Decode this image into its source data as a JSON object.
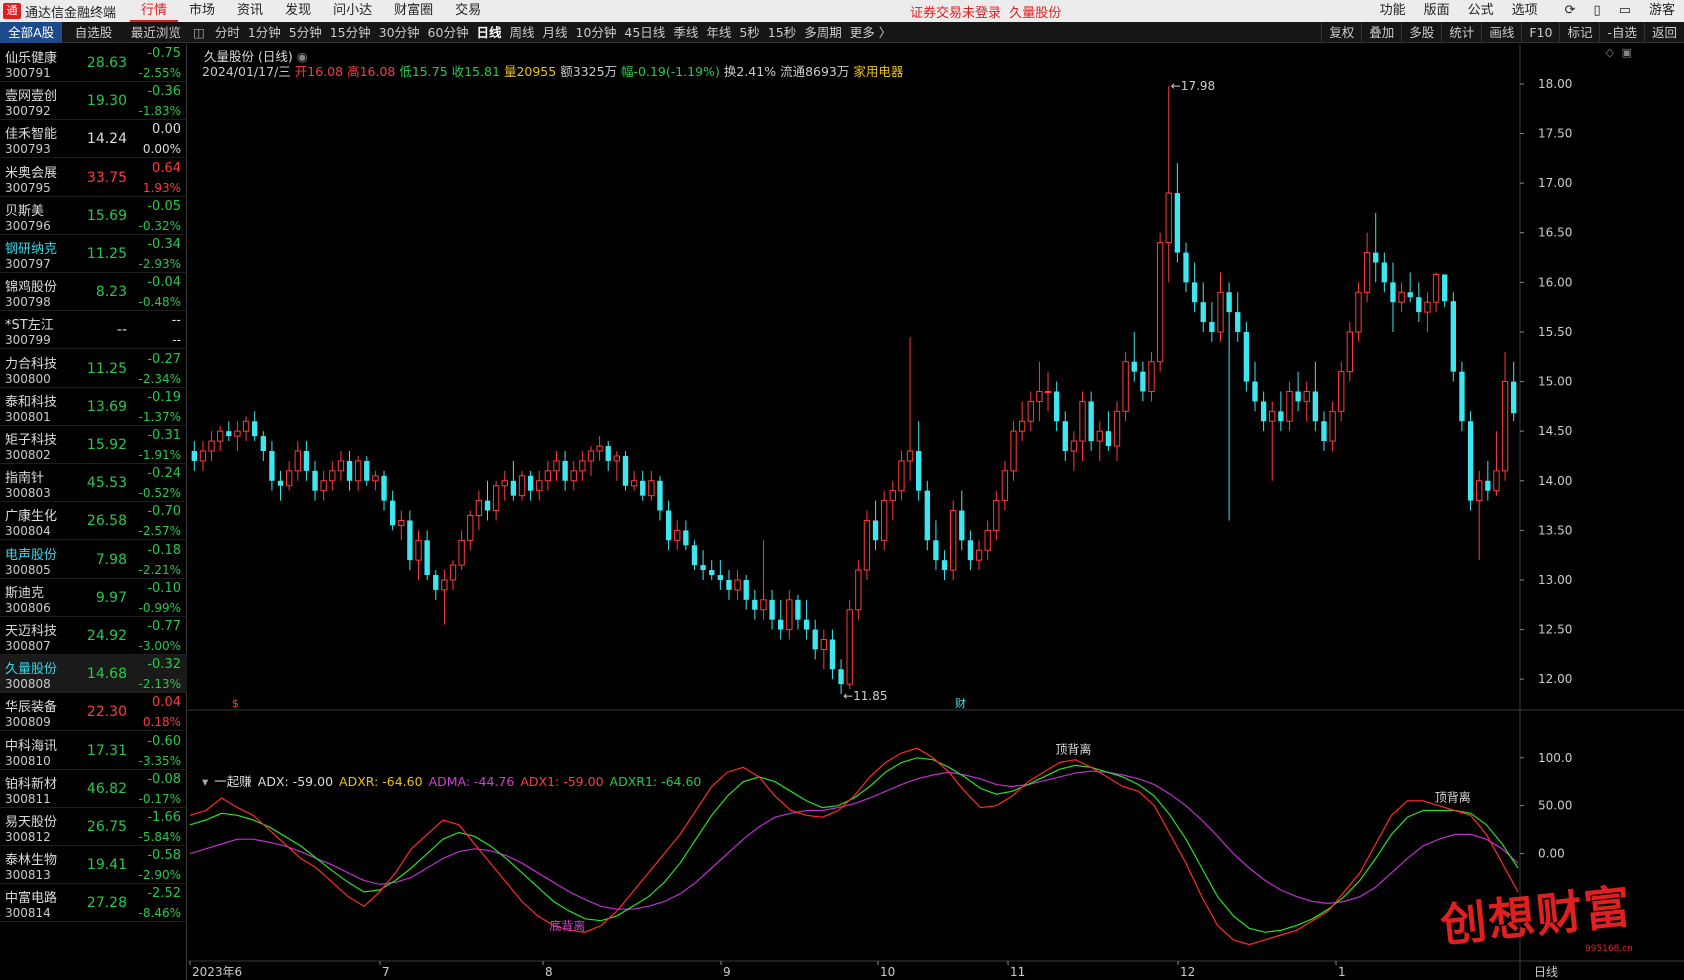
{
  "app": {
    "title": "通达信金融终端",
    "logo": "通",
    "notice": "证券交易未登录",
    "notice_stock": "久量股份"
  },
  "menu": [
    "行情",
    "市场",
    "资讯",
    "发现",
    "问小达",
    "财富圈",
    "交易"
  ],
  "menu_active": 0,
  "right_menu": [
    "功能",
    "版面",
    "公式",
    "选项"
  ],
  "guest": "游客",
  "sidebar_tabs": [
    "全部A股",
    "自选股",
    "最近浏览"
  ],
  "periods": [
    "分时",
    "1分钟",
    "5分钟",
    "15分钟",
    "30分钟",
    "60分钟",
    "日线",
    "周线",
    "月线",
    "10分钟",
    "45日线",
    "季线",
    "年线",
    "5秒",
    "15秒",
    "多周期",
    "更多 〉"
  ],
  "period_active": 6,
  "tools": [
    "复权",
    "叠加",
    "多股",
    "统计",
    "画线",
    "F10",
    "标记",
    "-自选",
    "返回"
  ],
  "stocks": [
    {
      "name": "仙乐健康",
      "code": "300791",
      "price": "28.63",
      "chg": "-0.75",
      "pct": "-2.55%",
      "dir": "dn"
    },
    {
      "name": "壹网壹创",
      "code": "300792",
      "price": "19.30",
      "chg": "-0.36",
      "pct": "-1.83%",
      "dir": "dn"
    },
    {
      "name": "佳禾智能",
      "code": "300793",
      "price": "14.24",
      "chg": "0.00",
      "pct": "0.00%",
      "dir": "fl"
    },
    {
      "name": "米奥会展",
      "code": "300795",
      "price": "33.75",
      "chg": "0.64",
      "pct": "1.93%",
      "dir": "up"
    },
    {
      "name": "贝斯美",
      "code": "300796",
      "price": "15.69",
      "chg": "-0.05",
      "pct": "-0.32%",
      "dir": "dn"
    },
    {
      "name": "钢研纳克",
      "code": "300797",
      "price": "11.25",
      "chg": "-0.34",
      "pct": "-2.93%",
      "dir": "dn",
      "hl": true
    },
    {
      "name": "锦鸡股份",
      "code": "300798",
      "price": "8.23",
      "chg": "-0.04",
      "pct": "-0.48%",
      "dir": "dn"
    },
    {
      "name": "*ST左江",
      "code": "300799",
      "price": "--",
      "chg": "--",
      "pct": "--",
      "dir": "fl"
    },
    {
      "name": "力合科技",
      "code": "300800",
      "price": "11.25",
      "chg": "-0.27",
      "pct": "-2.34%",
      "dir": "dn"
    },
    {
      "name": "泰和科技",
      "code": "300801",
      "price": "13.69",
      "chg": "-0.19",
      "pct": "-1.37%",
      "dir": "dn"
    },
    {
      "name": "矩子科技",
      "code": "300802",
      "price": "15.92",
      "chg": "-0.31",
      "pct": "-1.91%",
      "dir": "dn"
    },
    {
      "name": "指南针",
      "code": "300803",
      "price": "45.53",
      "chg": "-0.24",
      "pct": "-0.52%",
      "dir": "dn"
    },
    {
      "name": "广康生化",
      "code": "300804",
      "price": "26.58",
      "chg": "-0.70",
      "pct": "-2.57%",
      "dir": "dn"
    },
    {
      "name": "电声股份",
      "code": "300805",
      "price": "7.98",
      "chg": "-0.18",
      "pct": "-2.21%",
      "dir": "dn",
      "hl": true
    },
    {
      "name": "斯迪克",
      "code": "300806",
      "price": "9.97",
      "chg": "-0.10",
      "pct": "-0.99%",
      "dir": "dn"
    },
    {
      "name": "天迈科技",
      "code": "300807",
      "price": "24.92",
      "chg": "-0.77",
      "pct": "-3.00%",
      "dir": "dn"
    },
    {
      "name": "久量股份",
      "code": "300808",
      "price": "14.68",
      "chg": "-0.32",
      "pct": "-2.13%",
      "dir": "dn",
      "hl": true,
      "sel": true
    },
    {
      "name": "华辰装备",
      "code": "300809",
      "price": "22.30",
      "chg": "0.04",
      "pct": "0.18%",
      "dir": "up"
    },
    {
      "name": "中科海讯",
      "code": "300810",
      "price": "17.31",
      "chg": "-0.60",
      "pct": "-3.35%",
      "dir": "dn"
    },
    {
      "name": "铂科新材",
      "code": "300811",
      "price": "46.82",
      "chg": "-0.08",
      "pct": "-0.17%",
      "dir": "dn"
    },
    {
      "name": "易天股份",
      "code": "300812",
      "price": "26.75",
      "chg": "-1.66",
      "pct": "-5.84%",
      "dir": "dn"
    },
    {
      "name": "泰林生物",
      "code": "300813",
      "price": "19.41",
      "chg": "-0.58",
      "pct": "-2.90%",
      "dir": "dn"
    },
    {
      "name": "中富电路",
      "code": "300814",
      "price": "27.28",
      "chg": "-2.52",
      "pct": "-8.46%",
      "dir": "dn"
    }
  ],
  "chart": {
    "title": "久量股份 (日线)",
    "info": [
      {
        "t": "2024/01/17/三",
        "c": "#ccc"
      },
      {
        "t": "开16.08",
        "c": "#ff3b3b"
      },
      {
        "t": "高16.08",
        "c": "#ff3b3b"
      },
      {
        "t": "低15.75",
        "c": "#27c94a"
      },
      {
        "t": "收15.81",
        "c": "#27c94a"
      },
      {
        "t": "量20955",
        "c": "#e8c020"
      },
      {
        "t": "额3325万",
        "c": "#ccc"
      },
      {
        "t": "幅-0.19(-1.19%)",
        "c": "#27c94a"
      },
      {
        "t": "换2.41%",
        "c": "#ccc"
      },
      {
        "t": "流通8693万",
        "c": "#ccc"
      },
      {
        "t": "家用电器",
        "c": "#e8c020"
      }
    ],
    "max_label": "17.98",
    "min_label": "11.85",
    "marker_s": "$",
    "marker_cai": "财"
  },
  "indicator": {
    "name": "一起赚",
    "values": [
      {
        "t": "ADX: -59.00",
        "c": "#ddd"
      },
      {
        "t": "ADXR: -64.60",
        "c": "#e8c020"
      },
      {
        "t": "ADMA: -44.76",
        "c": "#d040d0"
      },
      {
        "t": "ADX1: -59.00",
        "c": "#ff3b3b"
      },
      {
        "t": "ADXR1: -64.60",
        "c": "#27c94a"
      }
    ],
    "labels": {
      "top1": "顶背离",
      "top2": "顶背离",
      "bottom": "底背离"
    }
  },
  "watermark": {
    "text": "创想财富",
    "site": "995168.cn"
  },
  "chart_data": {
    "type": "candlestick",
    "yaxis": [
      "18.00",
      "17.50",
      "17.00",
      "16.50",
      "16.00",
      "15.50",
      "15.00",
      "14.50",
      "14.00",
      "13.50",
      "13.00",
      "12.50",
      "12.00"
    ],
    "yaxis_ind": [
      "100.0",
      "50.00",
      "0.00"
    ],
    "xaxis": [
      "2023年6",
      "7",
      "8",
      "9",
      "10",
      "11",
      "12",
      "1"
    ],
    "xaxis_right": "日线",
    "candles": [
      [
        14.3,
        14.4,
        14.1,
        14.2
      ],
      [
        14.2,
        14.4,
        14.1,
        14.3
      ],
      [
        14.3,
        14.5,
        14.2,
        14.4
      ],
      [
        14.4,
        14.55,
        14.3,
        14.5
      ],
      [
        14.5,
        14.6,
        14.4,
        14.45
      ],
      [
        14.45,
        14.6,
        14.3,
        14.5
      ],
      [
        14.5,
        14.65,
        14.4,
        14.6
      ],
      [
        14.6,
        14.7,
        14.4,
        14.45
      ],
      [
        14.45,
        14.5,
        14.2,
        14.3
      ],
      [
        14.3,
        14.4,
        13.9,
        14.0
      ],
      [
        14.0,
        14.1,
        13.8,
        13.95
      ],
      [
        13.95,
        14.2,
        13.9,
        14.1
      ],
      [
        14.1,
        14.4,
        14.0,
        14.3
      ],
      [
        14.3,
        14.4,
        14.0,
        14.1
      ],
      [
        14.1,
        14.2,
        13.8,
        13.9
      ],
      [
        13.9,
        14.1,
        13.8,
        14.0
      ],
      [
        14.0,
        14.2,
        13.9,
        14.1
      ],
      [
        14.1,
        14.3,
        14.0,
        14.2
      ],
      [
        14.2,
        14.3,
        13.9,
        14.0
      ],
      [
        14.0,
        14.25,
        13.9,
        14.2
      ],
      [
        14.2,
        14.25,
        13.95,
        14.0
      ],
      [
        14.0,
        14.1,
        13.9,
        14.05
      ],
      [
        14.05,
        14.1,
        13.7,
        13.8
      ],
      [
        13.8,
        13.9,
        13.5,
        13.55
      ],
      [
        13.55,
        13.7,
        13.4,
        13.6
      ],
      [
        13.6,
        13.7,
        13.1,
        13.2
      ],
      [
        13.2,
        13.5,
        13.0,
        13.4
      ],
      [
        13.4,
        13.5,
        13.0,
        13.05
      ],
      [
        13.05,
        13.1,
        12.8,
        12.9
      ],
      [
        12.9,
        13.1,
        12.55,
        13.0
      ],
      [
        13.0,
        13.2,
        12.9,
        13.15
      ],
      [
        13.15,
        13.5,
        13.1,
        13.4
      ],
      [
        13.4,
        13.7,
        13.3,
        13.65
      ],
      [
        13.65,
        13.9,
        13.5,
        13.8
      ],
      [
        13.8,
        14.0,
        13.6,
        13.7
      ],
      [
        13.7,
        14.0,
        13.6,
        13.95
      ],
      [
        13.95,
        14.1,
        13.8,
        14.0
      ],
      [
        14.0,
        14.2,
        13.8,
        13.85
      ],
      [
        13.85,
        14.1,
        13.8,
        14.05
      ],
      [
        14.05,
        14.1,
        13.8,
        13.9
      ],
      [
        13.9,
        14.1,
        13.8,
        14.0
      ],
      [
        14.0,
        14.2,
        13.9,
        14.1
      ],
      [
        14.1,
        14.3,
        14.0,
        14.2
      ],
      [
        14.2,
        14.3,
        13.9,
        14.0
      ],
      [
        14.0,
        14.2,
        13.9,
        14.1
      ],
      [
        14.1,
        14.3,
        14.0,
        14.2
      ],
      [
        14.2,
        14.35,
        14.05,
        14.3
      ],
      [
        14.3,
        14.45,
        14.2,
        14.35
      ],
      [
        14.35,
        14.4,
        14.1,
        14.2
      ],
      [
        14.2,
        14.3,
        14.0,
        14.25
      ],
      [
        14.25,
        14.3,
        13.9,
        13.95
      ],
      [
        13.95,
        14.1,
        13.9,
        14.0
      ],
      [
        14.0,
        14.1,
        13.8,
        13.85
      ],
      [
        13.85,
        14.1,
        13.8,
        14.0
      ],
      [
        14.0,
        14.05,
        13.6,
        13.7
      ],
      [
        13.7,
        13.8,
        13.3,
        13.4
      ],
      [
        13.4,
        13.6,
        13.3,
        13.5
      ],
      [
        13.5,
        13.6,
        13.3,
        13.35
      ],
      [
        13.35,
        13.4,
        13.1,
        13.15
      ],
      [
        13.15,
        13.3,
        13.0,
        13.1
      ],
      [
        13.1,
        13.2,
        13.0,
        13.05
      ],
      [
        13.05,
        13.2,
        12.9,
        13.0
      ],
      [
        13.0,
        13.1,
        12.8,
        12.9
      ],
      [
        12.9,
        13.1,
        12.8,
        13.0
      ],
      [
        13.0,
        13.05,
        12.7,
        12.8
      ],
      [
        12.8,
        12.9,
        12.6,
        12.7
      ],
      [
        12.7,
        13.4,
        12.6,
        12.8
      ],
      [
        12.8,
        12.9,
        12.5,
        12.6
      ],
      [
        12.6,
        12.8,
        12.4,
        12.5
      ],
      [
        12.5,
        12.9,
        12.4,
        12.8
      ],
      [
        12.8,
        12.85,
        12.5,
        12.6
      ],
      [
        12.6,
        12.8,
        12.4,
        12.5
      ],
      [
        12.5,
        12.6,
        12.2,
        12.3
      ],
      [
        12.3,
        12.5,
        12.1,
        12.4
      ],
      [
        12.4,
        12.5,
        12.0,
        12.1
      ],
      [
        12.1,
        12.2,
        11.85,
        11.95
      ],
      [
        11.95,
        12.8,
        11.9,
        12.7
      ],
      [
        12.7,
        13.2,
        12.6,
        13.1
      ],
      [
        13.1,
        13.7,
        13.0,
        13.6
      ],
      [
        13.6,
        13.8,
        13.3,
        13.4
      ],
      [
        13.4,
        13.9,
        13.3,
        13.8
      ],
      [
        13.8,
        14.0,
        13.6,
        13.9
      ],
      [
        13.9,
        14.3,
        13.8,
        14.2
      ],
      [
        14.2,
        15.45,
        14.0,
        14.3
      ],
      [
        14.3,
        14.6,
        13.8,
        13.9
      ],
      [
        13.9,
        14.0,
        13.3,
        13.4
      ],
      [
        13.4,
        13.6,
        13.1,
        13.2
      ],
      [
        13.2,
        13.3,
        13.0,
        13.1
      ],
      [
        13.1,
        13.8,
        13.0,
        13.7
      ],
      [
        13.7,
        13.9,
        13.3,
        13.4
      ],
      [
        13.4,
        13.5,
        13.1,
        13.2
      ],
      [
        13.2,
        13.4,
        13.1,
        13.3
      ],
      [
        13.3,
        13.6,
        13.2,
        13.5
      ],
      [
        13.5,
        13.9,
        13.4,
        13.8
      ],
      [
        13.8,
        14.2,
        13.7,
        14.1
      ],
      [
        14.1,
        14.6,
        14.0,
        14.5
      ],
      [
        14.5,
        14.8,
        14.4,
        14.6
      ],
      [
        14.6,
        14.9,
        14.5,
        14.8
      ],
      [
        14.8,
        15.2,
        14.6,
        14.9
      ],
      [
        14.9,
        15.1,
        14.7,
        14.9
      ],
      [
        14.9,
        15.0,
        14.5,
        14.6
      ],
      [
        14.6,
        14.7,
        14.2,
        14.3
      ],
      [
        14.3,
        14.5,
        14.1,
        14.4
      ],
      [
        14.4,
        14.9,
        14.2,
        14.8
      ],
      [
        14.8,
        14.9,
        14.3,
        14.4
      ],
      [
        14.4,
        14.6,
        14.2,
        14.5
      ],
      [
        14.5,
        14.7,
        14.3,
        14.35
      ],
      [
        14.35,
        14.8,
        14.2,
        14.7
      ],
      [
        14.7,
        15.3,
        14.6,
        15.2
      ],
      [
        15.2,
        15.5,
        15.0,
        15.1
      ],
      [
        15.1,
        15.2,
        14.8,
        14.9
      ],
      [
        14.9,
        15.3,
        14.8,
        15.2
      ],
      [
        15.2,
        16.5,
        15.1,
        16.4
      ],
      [
        16.4,
        17.98,
        16.0,
        16.9
      ],
      [
        16.9,
        17.2,
        16.2,
        16.3
      ],
      [
        16.3,
        16.4,
        15.9,
        16.0
      ],
      [
        16.0,
        16.2,
        15.7,
        15.8
      ],
      [
        15.8,
        16.0,
        15.5,
        15.6
      ],
      [
        15.6,
        15.8,
        15.4,
        15.5
      ],
      [
        15.5,
        16.1,
        15.4,
        15.9
      ],
      [
        15.9,
        16.0,
        13.6,
        15.7
      ],
      [
        15.7,
        15.9,
        15.4,
        15.5
      ],
      [
        15.5,
        15.6,
        14.9,
        15.0
      ],
      [
        15.0,
        15.2,
        14.7,
        14.8
      ],
      [
        14.8,
        14.9,
        14.5,
        14.6
      ],
      [
        14.6,
        14.8,
        14.0,
        14.7
      ],
      [
        14.7,
        14.9,
        14.5,
        14.6
      ],
      [
        14.6,
        15.0,
        14.5,
        14.9
      ],
      [
        14.9,
        15.1,
        14.7,
        14.8
      ],
      [
        14.8,
        15.0,
        14.6,
        14.9
      ],
      [
        14.9,
        15.2,
        14.5,
        14.6
      ],
      [
        14.6,
        14.7,
        14.3,
        14.4
      ],
      [
        14.4,
        14.8,
        14.3,
        14.7
      ],
      [
        14.7,
        15.2,
        14.6,
        15.1
      ],
      [
        15.1,
        15.6,
        15.0,
        15.5
      ],
      [
        15.5,
        16.0,
        15.4,
        15.9
      ],
      [
        15.9,
        16.5,
        15.8,
        16.3
      ],
      [
        16.3,
        16.7,
        16.0,
        16.2
      ],
      [
        16.2,
        16.3,
        15.9,
        16.0
      ],
      [
        16.0,
        16.2,
        15.5,
        15.8
      ],
      [
        15.8,
        16.0,
        15.7,
        15.9
      ],
      [
        15.9,
        16.1,
        15.8,
        15.85
      ],
      [
        15.85,
        16.0,
        15.6,
        15.7
      ],
      [
        15.7,
        15.9,
        15.5,
        15.8
      ],
      [
        15.8,
        16.1,
        15.7,
        16.08
      ],
      [
        16.08,
        16.08,
        15.75,
        15.81
      ],
      [
        15.81,
        15.9,
        15.0,
        15.1
      ],
      [
        15.1,
        15.2,
        14.5,
        14.6
      ],
      [
        14.6,
        14.7,
        13.7,
        13.8
      ],
      [
        13.8,
        14.1,
        13.2,
        14.0
      ],
      [
        14.0,
        14.2,
        13.8,
        13.9
      ],
      [
        13.9,
        14.5,
        13.85,
        14.1
      ],
      [
        14.1,
        15.3,
        14.0,
        15.0
      ],
      [
        15.0,
        15.2,
        14.6,
        14.68
      ]
    ],
    "ind_red": [
      40,
      45,
      58,
      48,
      40,
      25,
      10,
      -5,
      -15,
      -30,
      -45,
      -55,
      -40,
      -20,
      5,
      20,
      35,
      30,
      10,
      -10,
      -30,
      -50,
      -65,
      -75,
      -80,
      -82,
      -75,
      -60,
      -40,
      -20,
      0,
      20,
      45,
      70,
      85,
      90,
      80,
      60,
      45,
      40,
      38,
      45,
      60,
      80,
      95,
      105,
      110,
      100,
      85,
      65,
      48,
      50,
      60,
      75,
      85,
      95,
      98,
      90,
      80,
      70,
      65,
      50,
      20,
      -10,
      -45,
      -75,
      -90,
      -95,
      -90,
      -85,
      -80,
      -70,
      -60,
      -40,
      -20,
      10,
      40,
      55,
      55,
      50,
      45,
      40,
      20,
      -10,
      -40
    ],
    "ind_green": [
      30,
      35,
      42,
      40,
      35,
      28,
      18,
      8,
      -5,
      -18,
      -30,
      -40,
      -38,
      -28,
      -15,
      0,
      15,
      22,
      18,
      8,
      -5,
      -20,
      -35,
      -50,
      -60,
      -68,
      -70,
      -65,
      -55,
      -45,
      -30,
      -10,
      15,
      40,
      60,
      75,
      80,
      75,
      65,
      55,
      48,
      50,
      58,
      70,
      85,
      95,
      100,
      98,
      90,
      80,
      68,
      62,
      65,
      72,
      80,
      88,
      92,
      90,
      85,
      80,
      72,
      60,
      40,
      15,
      -15,
      -45,
      -65,
      -78,
      -82,
      -80,
      -75,
      -68,
      -58,
      -45,
      -28,
      -5,
      20,
      38,
      45,
      45,
      45,
      42,
      30,
      10,
      -15
    ],
    "ind_magenta": [
      0,
      5,
      10,
      15,
      15,
      12,
      8,
      2,
      -5,
      -12,
      -20,
      -28,
      -32,
      -30,
      -25,
      -15,
      -5,
      2,
      5,
      3,
      -2,
      -10,
      -20,
      -30,
      -40,
      -48,
      -55,
      -58,
      -58,
      -55,
      -50,
      -42,
      -30,
      -15,
      0,
      15,
      28,
      38,
      42,
      45,
      45,
      48,
      52,
      58,
      65,
      72,
      78,
      82,
      85,
      82,
      78,
      72,
      70,
      72,
      76,
      80,
      84,
      86,
      85,
      82,
      78,
      72,
      62,
      50,
      35,
      18,
      0,
      -15,
      -28,
      -38,
      -45,
      -50,
      -52,
      -50,
      -45,
      -35,
      -20,
      -5,
      8,
      15,
      20,
      20,
      15,
      5,
      -10
    ]
  }
}
